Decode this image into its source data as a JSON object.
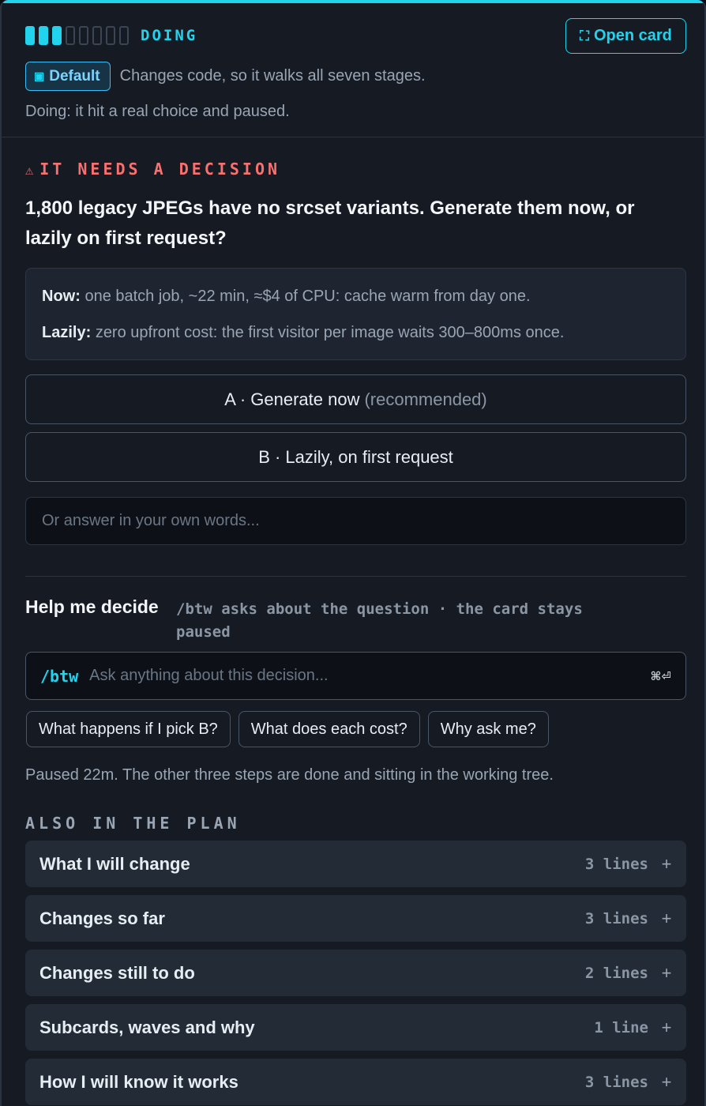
{
  "header": {
    "stage": {
      "done": 3,
      "total": 8,
      "label": "DOING"
    },
    "open_card_label": "Open card",
    "mode_badge": "Default",
    "mode_description": "Changes code, so it walks all seven stages.",
    "status_line": "Doing: it hit a real choice and paused."
  },
  "decision": {
    "heading": "IT NEEDS A DECISION",
    "question": "1,800 legacy JPEGs have no srcset variants. Generate them now, or lazily on first request?",
    "tradeoffs": [
      {
        "label": "Now:",
        "text": "one batch job, ~22 min, ≈$4 of CPU: cache warm from day one."
      },
      {
        "label": "Lazily:",
        "text": "zero upfront cost: the first visitor per image waits 300–800ms once."
      }
    ],
    "options": [
      {
        "label": "A · Generate now",
        "note": "(recommended)"
      },
      {
        "label": "B · Lazily, on first request",
        "note": ""
      }
    ],
    "answer_placeholder": "Or answer in your own words..."
  },
  "help": {
    "title": "Help me decide",
    "hint": "/btw asks about the question · the card stays paused",
    "prefix": "/btw",
    "placeholder": "Ask anything about this decision...",
    "shortcut": "⌘⏎",
    "chips": [
      "What happens if I pick B?",
      "What does each cost?",
      "Why ask me?"
    ],
    "paused_note": "Paused 22m. The other three steps are done and sitting in the working tree."
  },
  "plan": {
    "heading": "ALSO IN THE PLAN",
    "sections": [
      {
        "title": "What I will change",
        "count": "3 lines"
      },
      {
        "title": "Changes so far",
        "count": "3 lines"
      },
      {
        "title": "Changes still to do",
        "count": "2 lines"
      },
      {
        "title": "Subcards, waves and why",
        "count": "1 line"
      },
      {
        "title": "How I will know it works",
        "count": "3 lines"
      }
    ],
    "expand_glyph": "+"
  },
  "colors": {
    "accent": "#22d3ee",
    "alert": "#f87171",
    "surface": "#161b23"
  },
  "icons": {
    "open_card": "expand-icon",
    "mode": "square-icon",
    "alert": "warning-icon",
    "submit": "enter-icon"
  }
}
